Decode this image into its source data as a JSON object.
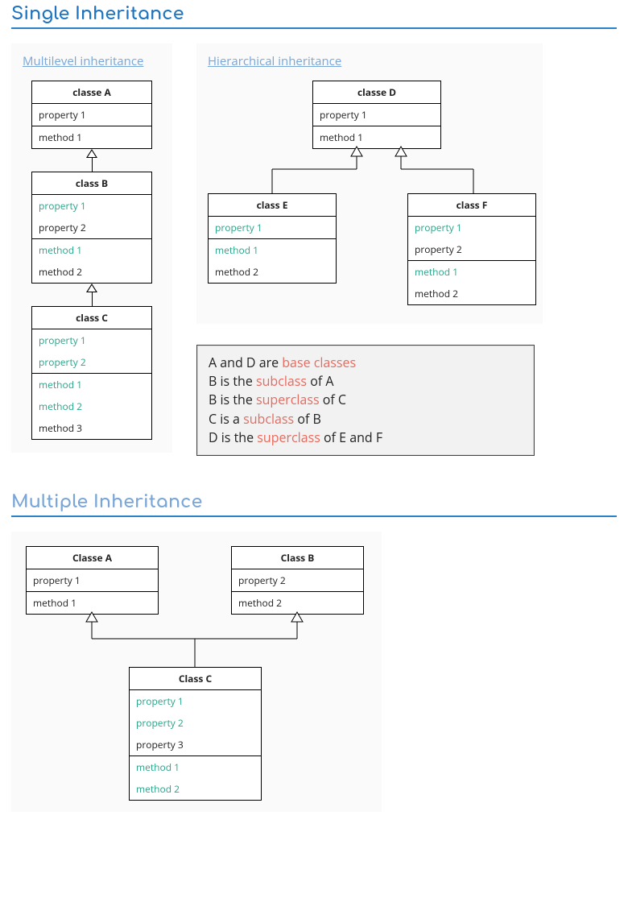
{
  "headings": {
    "single": "Single Inheritance",
    "multiple": "Multiple Inheritance"
  },
  "multilevel": {
    "title": "Multilevel inheritance",
    "a": {
      "name": "classe A",
      "props": [
        "property 1"
      ],
      "methods": [
        "method 1"
      ]
    },
    "b": {
      "name": "class B",
      "props": [
        "property 1",
        "property 2"
      ],
      "propsInherited": [
        true,
        false
      ],
      "methods": [
        "method 1",
        "method 2"
      ],
      "methodsInherited": [
        true,
        false
      ]
    },
    "c": {
      "name": "class C",
      "props": [
        "property 1",
        "property 2"
      ],
      "propsInherited": [
        true,
        true
      ],
      "methods": [
        "method 1",
        "method 2",
        "method 3"
      ],
      "methodsInherited": [
        true,
        true,
        false
      ]
    }
  },
  "hierarchical": {
    "title": "Hierarchical inheritance",
    "d": {
      "name": "classe D",
      "props": [
        "property 1"
      ],
      "methods": [
        "method 1"
      ]
    },
    "e": {
      "name": "class E",
      "props": [
        "property 1"
      ],
      "propsInherited": [
        true
      ],
      "methods": [
        "method 1",
        "method 2"
      ],
      "methodsInherited": [
        true,
        false
      ]
    },
    "f": {
      "name": "class F",
      "props": [
        "property 1",
        "property 2"
      ],
      "propsInherited": [
        true,
        false
      ],
      "methods": [
        "method 1",
        "method 2"
      ],
      "methodsInherited": [
        true,
        false
      ]
    }
  },
  "notes": {
    "l1a": "A and D are ",
    "l1b": "base classes",
    "l2a": "B is the ",
    "l2b": "subclass",
    "l2c": " of A",
    "l3a": "B is the ",
    "l3b": "superclass",
    "l3c": " of C",
    "l4a": "C is a ",
    "l4b": "subclass",
    "l4c": " of B",
    "l5a": "D is the ",
    "l5b": "superclass",
    "l5c": " of E and F"
  },
  "multiple": {
    "a": {
      "name": "Classe A",
      "props": [
        "property 1"
      ],
      "methods": [
        "method 1"
      ]
    },
    "b": {
      "name": "Class B",
      "props": [
        "property 2"
      ],
      "methods": [
        "method 2"
      ]
    },
    "c": {
      "name": "Class C",
      "props": [
        "property 1",
        "property 2",
        "property 3"
      ],
      "propsInherited": [
        true,
        true,
        false
      ],
      "methods": [
        "method 1",
        "method 2"
      ],
      "methodsInherited": [
        true,
        true
      ]
    }
  }
}
